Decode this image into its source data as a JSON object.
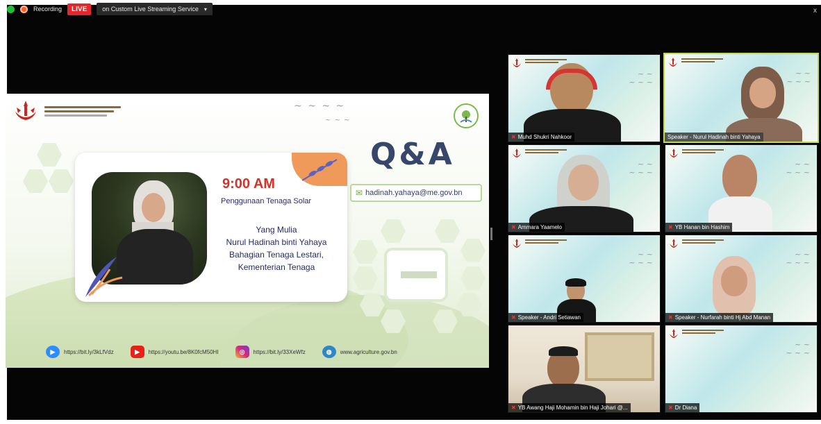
{
  "topbar": {
    "recording_label": "Recording",
    "live_label": "LIVE",
    "stream_label": "on Custom Live Streaming Service",
    "caret": "▾",
    "close": "x"
  },
  "slide": {
    "time": "9:00 AM",
    "topic": "Penggunaan Tenaga Solar",
    "speaker_lines": [
      "Yang Mulia",
      "Nurul Hadinah binti Yahaya",
      "Bahagian Tenaga Lestari,",
      "Kementerian Tenaga"
    ],
    "qa_title": "Q&A",
    "email": "hadinah.yahaya@me.gov.bn",
    "social": [
      {
        "icon": "zoom-icon",
        "text": "https://bit.ly/3kLfVdz"
      },
      {
        "icon": "youtube-icon",
        "text": "https://youtu.be/8K0fcM50HI"
      },
      {
        "icon": "instagram-icon",
        "text": "https://bit.ly/33XeWfz"
      },
      {
        "icon": "web-icon",
        "text": "www.agriculture.gov.bn"
      }
    ]
  },
  "participants": [
    {
      "name": "Muhd Shukri Nahkoor"
    },
    {
      "name": "Speaker - Nurul Hadinah binti Yahaya"
    },
    {
      "name": "Ammara Yaamelo"
    },
    {
      "name": "YB Hanan bin Hashim"
    },
    {
      "name": "Speaker - Andri Setiawan"
    },
    {
      "name": "Speaker - Nurfarah binti Hj Abd Manan"
    },
    {
      "name": "YB Awang Haji Mohamin bin Haji Johari @..."
    },
    {
      "name": "Dr Diana"
    }
  ]
}
